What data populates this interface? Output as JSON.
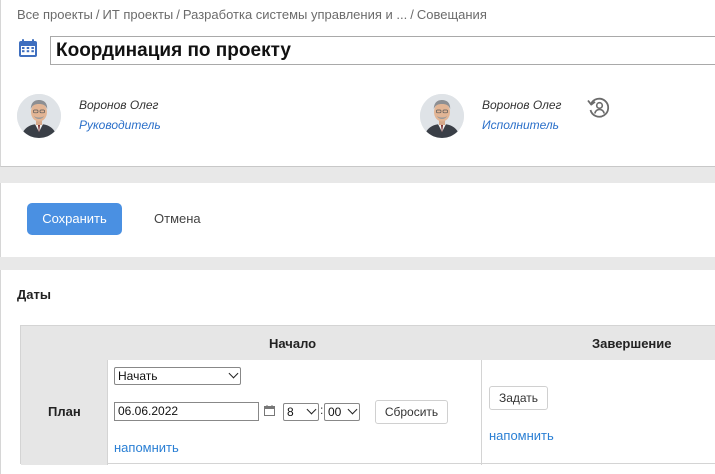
{
  "breadcrumb": [
    "Все проекты",
    "ИТ проекты",
    "Разработка системы управления и ...",
    "Совещания"
  ],
  "title": "Координация по проекту",
  "people": [
    {
      "name": "Воронов Олег",
      "role": "Руководитель"
    },
    {
      "name": "Воронов Олег",
      "role": "Исполнитель"
    }
  ],
  "actions": {
    "save": "Сохранить",
    "cancel": "Отмена"
  },
  "dates": {
    "section_title": "Даты",
    "columns": {
      "start": "Начало",
      "end": "Завершение"
    },
    "row_label": "План",
    "start": {
      "mode": "Начать",
      "date": "06.06.2022",
      "hour": "8",
      "minute": "00",
      "reset": "Сбросить",
      "remind": "напомнить"
    },
    "end": {
      "set": "Задать",
      "remind": "напомнить"
    }
  },
  "colors": {
    "accent": "#4a90e2",
    "link": "#2a7fd4"
  }
}
